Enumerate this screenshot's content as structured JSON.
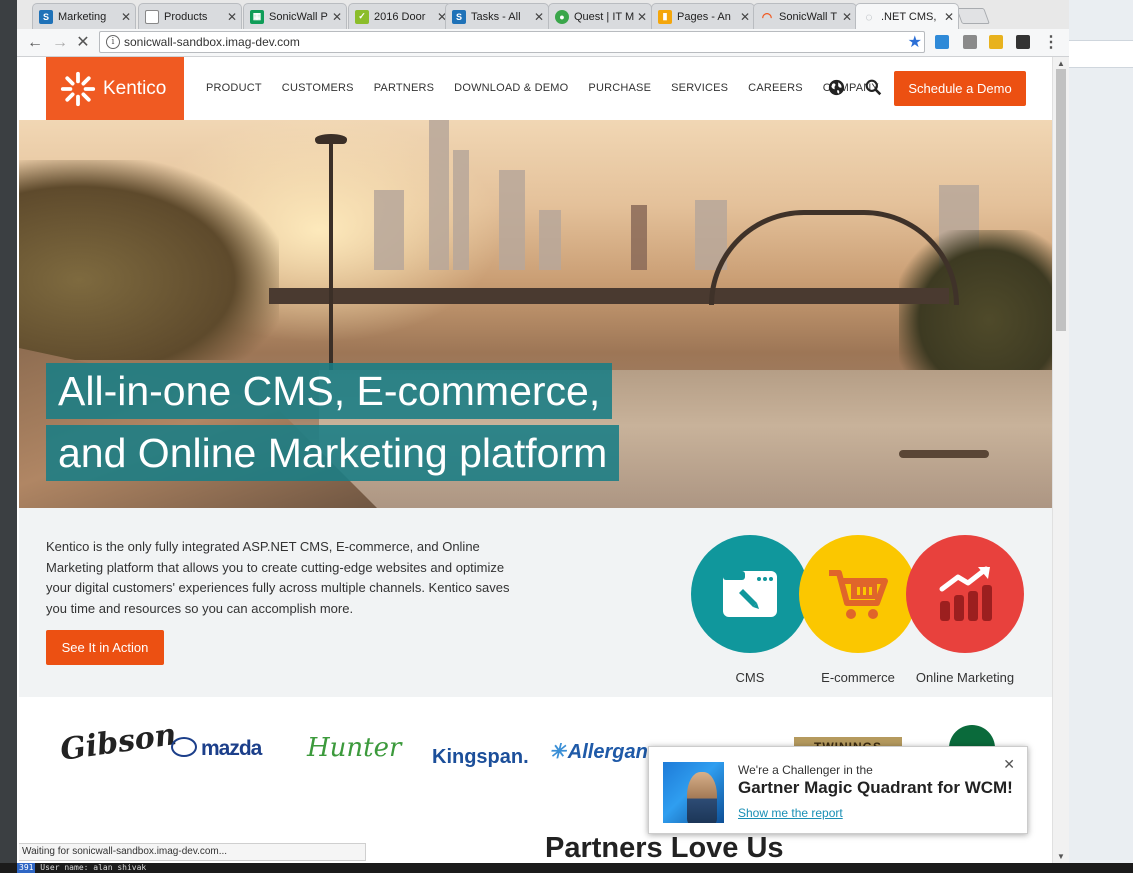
{
  "browser": {
    "tabs": [
      {
        "title": "Marketing",
        "favicon": "sharepoint-icon",
        "color": "#1f72b8",
        "active": false
      },
      {
        "title": "Products",
        "favicon": "document-icon",
        "color": "#ffffff",
        "active": false
      },
      {
        "title": "SonicWall P",
        "favicon": "sheets-icon",
        "color": "#0f9d58",
        "active": false
      },
      {
        "title": "2016 Door",
        "favicon": "smartsheet-icon",
        "color": "#8bbd2a",
        "active": false
      },
      {
        "title": "Tasks - All",
        "favicon": "sharepoint-icon",
        "color": "#1f72b8",
        "active": false
      },
      {
        "title": "Quest | IT M",
        "favicon": "quest-icon",
        "color": "#3aa64a",
        "active": false
      },
      {
        "title": "Pages - An",
        "favicon": "analytics-icon",
        "color": "#f4a60b",
        "active": false
      },
      {
        "title": "SonicWall T",
        "favicon": "sonicwall-icon",
        "color": "#f05a22",
        "active": false
      },
      {
        "title": ".NET CMS,",
        "favicon": "loading-icon",
        "color": "#9aa0a6",
        "active": true
      }
    ],
    "url": "sonicwall-sandbox.imag-dev.com",
    "status_text": "Waiting for sonicwall-sandbox.imag-dev.com..."
  },
  "site": {
    "logo_text": "Kentico",
    "nav": [
      "PRODUCT",
      "CUSTOMERS",
      "PARTNERS",
      "DOWNLOAD & DEMO",
      "PURCHASE",
      "SERVICES",
      "CAREERS",
      "COMPANY"
    ],
    "demo_button": "Schedule a Demo",
    "hero_line1": "All-in-one CMS, E-commerce,",
    "hero_line2": "and Online Marketing platform",
    "intro": "Kentico is the only fully integrated ASP.NET CMS, E-commerce, and Online Marketing platform that allows you to create cutting-edge websites and optimize your digital customers' experiences fully across multiple channels. Kentico saves you time and resources so you can accomplish more.",
    "action_button": "See It in Action",
    "features": [
      {
        "label": "CMS",
        "color": "#10979c"
      },
      {
        "label": "E-commerce",
        "color": "#fbc700"
      },
      {
        "label": "Online Marketing",
        "color": "#e8413d"
      }
    ],
    "brands": {
      "gibson": "Gibson",
      "mazda": "mazda",
      "hunter": "Hunter",
      "kingspan": "Kingspan.",
      "allergan": "Allergan",
      "twinings": "TWININGS"
    },
    "section_title": "Partners Love Us"
  },
  "toast": {
    "kicker": "We're a Challenger in the",
    "headline": "Gartner Magic Quadrant for WCM!",
    "link": "Show me the report"
  },
  "taskbar": {
    "number": "391",
    "text": "User name: alan shivak"
  },
  "colors": {
    "accent": "#ec5012",
    "hero_band": "#197d85",
    "link": "#1a8fb5"
  }
}
